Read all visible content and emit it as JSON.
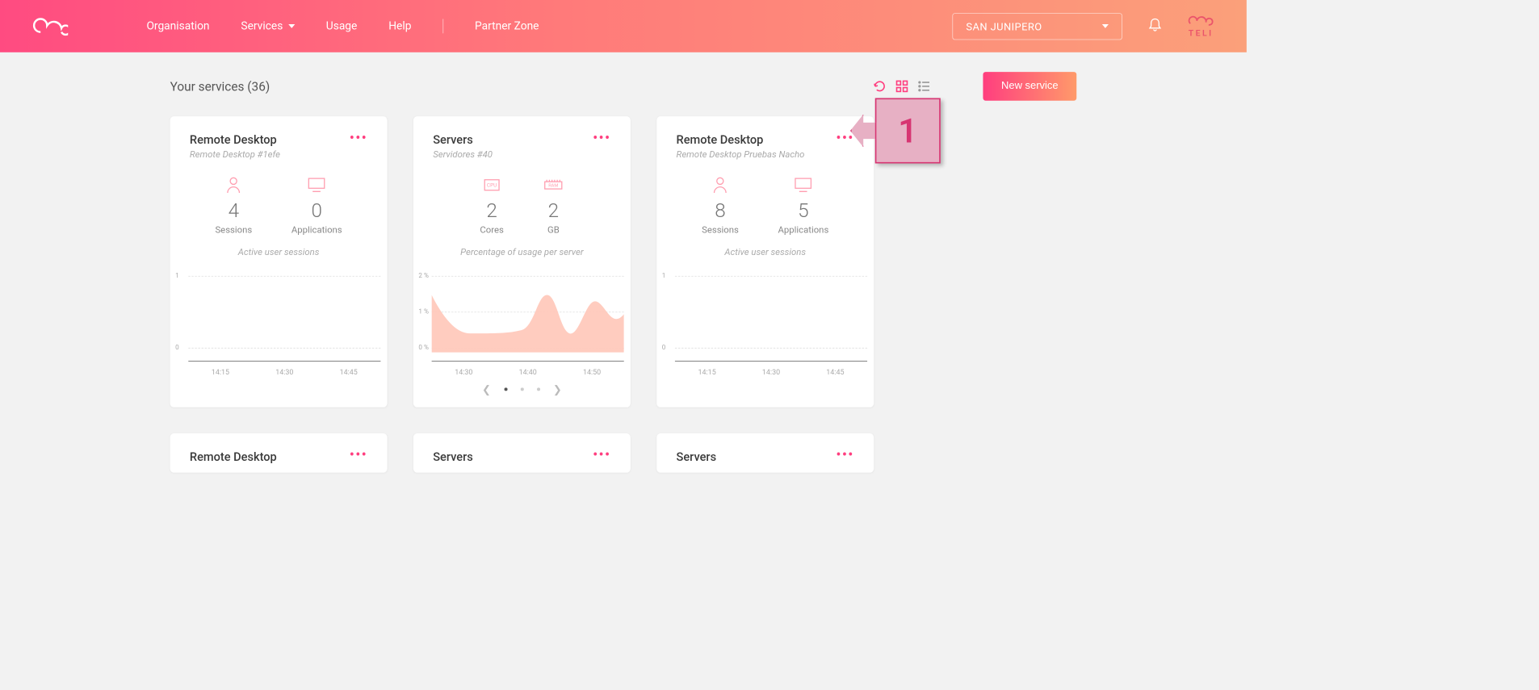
{
  "header": {
    "nav": {
      "organisation": "Organisation",
      "services": "Services",
      "usage": "Usage",
      "help": "Help",
      "partner": "Partner Zone"
    },
    "org_select": "SAN JUNIPERO",
    "right_label": "TELI"
  },
  "page": {
    "title": "Your services (36)",
    "new_button": "New service"
  },
  "cards": [
    {
      "title": "Remote Desktop",
      "subtitle": "Remote Desktop #1efe",
      "stats": [
        {
          "icon": "user",
          "value": "4",
          "label": "Sessions"
        },
        {
          "icon": "monitor",
          "value": "0",
          "label": "Applications"
        }
      ],
      "caption": "Active user sessions",
      "chart": {
        "yticks": [
          "1",
          "0"
        ],
        "xticks": [
          "14:15",
          "14:30",
          "14:45"
        ],
        "type": "flat"
      }
    },
    {
      "title": "Servers",
      "subtitle": "Servidores #40",
      "stats": [
        {
          "icon": "cpu",
          "value": "2",
          "label": "Cores"
        },
        {
          "icon": "ram",
          "value": "2",
          "label": "GB"
        }
      ],
      "caption": "Percentage of usage per server",
      "chart": {
        "yticks": [
          "2 %",
          "1 %",
          "0 %"
        ],
        "xticks": [
          "14:30",
          "14:40",
          "14:50"
        ],
        "type": "area"
      },
      "pager": true
    },
    {
      "title": "Remote Desktop",
      "subtitle": "Remote Desktop Pruebas Nacho",
      "stats": [
        {
          "icon": "user",
          "value": "8",
          "label": "Sessions"
        },
        {
          "icon": "monitor",
          "value": "5",
          "label": "Applications"
        }
      ],
      "caption": "Active user sessions",
      "chart": {
        "yticks": [
          "1",
          "0"
        ],
        "xticks": [
          "14:15",
          "14:30",
          "14:45"
        ],
        "type": "flat"
      }
    },
    {
      "title": "Remote Desktop",
      "partial": true
    },
    {
      "title": "Servers",
      "partial": true
    },
    {
      "title": "Servers",
      "partial": true
    }
  ],
  "callout": "1",
  "chart_data": [
    {
      "type": "line",
      "card": "Remote Desktop #1efe",
      "title": "Active user sessions",
      "x": [
        "14:15",
        "14:30",
        "14:45"
      ],
      "values": [
        0,
        0,
        0
      ],
      "ylim": [
        0,
        1
      ]
    },
    {
      "type": "area",
      "card": "Servidores #40",
      "title": "Percentage of usage per server",
      "x": [
        "14:30",
        "14:32",
        "14:34",
        "14:36",
        "14:38",
        "14:40",
        "14:42",
        "14:44",
        "14:46",
        "14:48",
        "14:50",
        "14:52"
      ],
      "values": [
        1.4,
        0.7,
        0.5,
        0.5,
        0.5,
        0.5,
        1.4,
        0.6,
        0.5,
        1.3,
        0.5,
        1.1
      ],
      "ylabel": "%",
      "ylim": [
        0,
        2
      ]
    },
    {
      "type": "line",
      "card": "Remote Desktop Pruebas Nacho",
      "title": "Active user sessions",
      "x": [
        "14:15",
        "14:30",
        "14:45"
      ],
      "values": [
        0,
        0,
        0
      ],
      "ylim": [
        0,
        1
      ]
    }
  ]
}
